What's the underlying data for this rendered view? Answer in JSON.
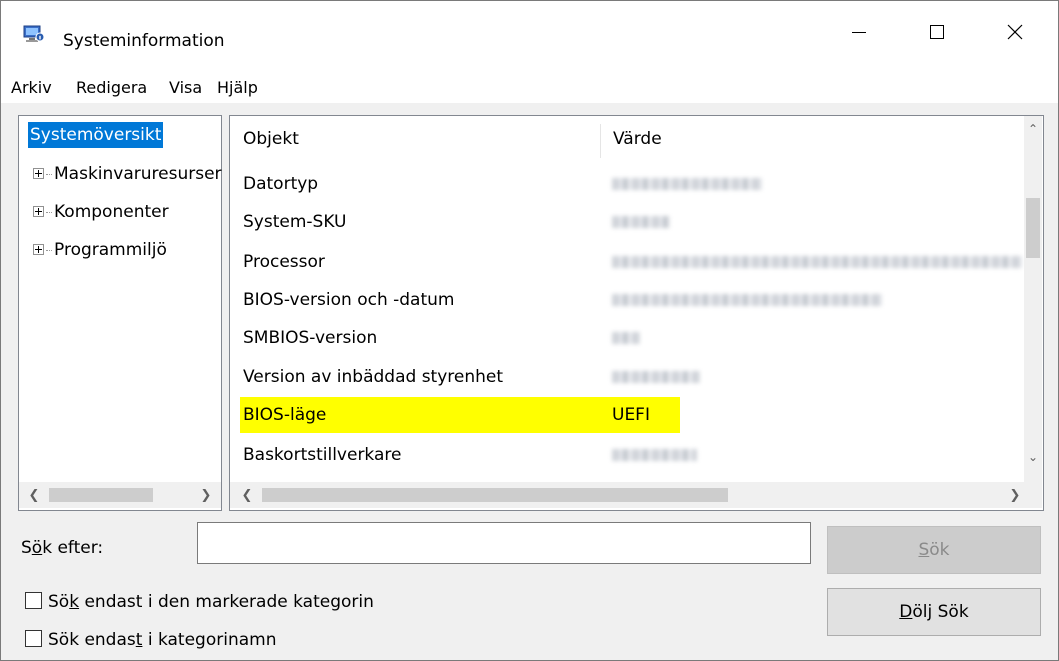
{
  "window": {
    "title": "Systeminformation",
    "icon": "system-information-icon",
    "controls": {
      "minimize": "minimize-icon",
      "maximize": "maximize-icon",
      "close": "close-icon"
    }
  },
  "menu": {
    "items": [
      "Arkiv",
      "Redigera",
      "Visa",
      "Hjälp"
    ]
  },
  "tree": {
    "selected": "Systemöversikt",
    "items": [
      "Maskinvaruresurser",
      "Komponenter",
      "Programmiljö"
    ]
  },
  "list": {
    "columns": [
      "Objekt",
      "Värde"
    ],
    "rows": [
      {
        "label": "Datortyp",
        "value": ""
      },
      {
        "label": "System-SKU",
        "value": ""
      },
      {
        "label": "Processor",
        "value": ""
      },
      {
        "label": "BIOS-version och -datum",
        "value": ""
      },
      {
        "label": "SMBIOS-version",
        "value": ""
      },
      {
        "label": "Version av inbäddad styrenhet",
        "value": ""
      },
      {
        "label": "BIOS-läge",
        "value": "UEFI",
        "highlighted": true
      },
      {
        "label": "Baskortstillverkare",
        "value": ""
      }
    ],
    "highlight_color": "#ffff00"
  },
  "search": {
    "label_prefix": "S",
    "label_underline": "ö",
    "label_suffix": "k efter:",
    "input_value": "",
    "search_button": {
      "prefix": "",
      "underline": "S",
      "suffix": "ök"
    },
    "hide_button": {
      "prefix": "",
      "underline": "D",
      "suffix": "ölj Sök"
    },
    "checkbox1": {
      "prefix": "Sö",
      "underline": "k",
      "suffix": " endast i den markerade kategorin",
      "checked": false
    },
    "checkbox2": {
      "prefix": "Sök endas",
      "underline": "t",
      "suffix": " i kategorinamn",
      "checked": false
    }
  },
  "colors": {
    "selection": "#0078d7",
    "highlight": "#ffff00"
  }
}
